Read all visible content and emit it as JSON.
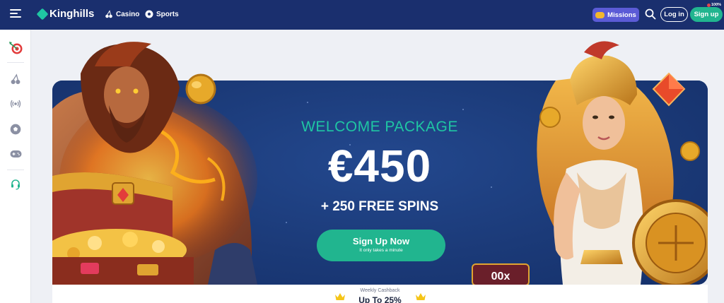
{
  "header": {
    "logo_text": "Kinghills",
    "nav": [
      {
        "label": "Casino",
        "icon": "cherries-icon"
      },
      {
        "label": "Sports",
        "icon": "football-icon"
      }
    ],
    "missions_label": "Missions",
    "login_label": "Log in",
    "signup_label": "Sign up",
    "signup_badge": "100%"
  },
  "sidebar": {
    "items": [
      {
        "icon": "dart-target-icon"
      },
      {
        "icon": "cherries-icon"
      },
      {
        "icon": "live-broadcast-icon"
      },
      {
        "icon": "football-icon"
      },
      {
        "icon": "gamepad-icon"
      },
      {
        "icon": "headset-support-icon"
      }
    ]
  },
  "banner": {
    "headline": "WELCOME PACKAGE",
    "amount": "€450",
    "spins": "+ 250 FREE SPINS",
    "cta_label": "Sign Up Now",
    "cta_sub": "It only takes a minute"
  },
  "cashback": {
    "label": "Weekly Cashback",
    "value": "Up To 25%"
  },
  "colors": {
    "topbar": "#1a2f6e",
    "accent": "#21b58f",
    "headline": "#1fc6a3",
    "missions": "#5b5bd6",
    "banner": "#1b3a78"
  }
}
